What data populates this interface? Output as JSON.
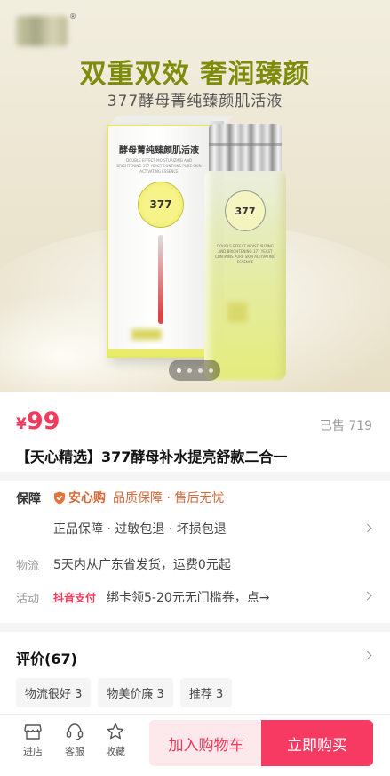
{
  "hero": {
    "logo_mark": "®",
    "headline": "双重双效 奢润臻颜",
    "subline": "377酵母菁纯臻颜肌活液",
    "box_title": "酵母菁纯臻颜肌活液",
    "box_small_text": "DOUBLE EFFECT MOISTURIZING AND BRIGHTENING 377 YEAST CONTAINS PURE SKIN ACTIVATING ESSENCE",
    "badge_text": "377",
    "image_count": 4,
    "active_image": 0
  },
  "price": {
    "currency": "¥",
    "value": "99",
    "sold": "已售 719"
  },
  "product": {
    "title": "【天心精选】377酵母补水提亮舒款二合一"
  },
  "service": {
    "guarantee_label": "保障",
    "guarantee_brand": "安心购",
    "guarantee_features": "品质保障 · 售后无忧",
    "guarantee_sub": "正品保障 · 过敏包退 · 坏损包退",
    "shipping_label": "物流",
    "shipping_text": "5天内从广东省发货，运费0元起",
    "activity_label": "活动",
    "activity_tag": "抖音支付",
    "activity_text": "绑卡领5-20元无门槛券，点→"
  },
  "reviews": {
    "title": "评价(67)",
    "tags": [
      "物流很好 3",
      "物美价廉 3",
      "推荐 3"
    ]
  },
  "bottom_bar": {
    "store": "进店",
    "service": "客服",
    "favorite": "收藏",
    "add_to_cart": "加入购物车",
    "buy_now": "立即购买"
  },
  "colors": {
    "accent": "#f23a5b",
    "headline": "#7d8c0a",
    "guarantee": "#d86a3a"
  }
}
